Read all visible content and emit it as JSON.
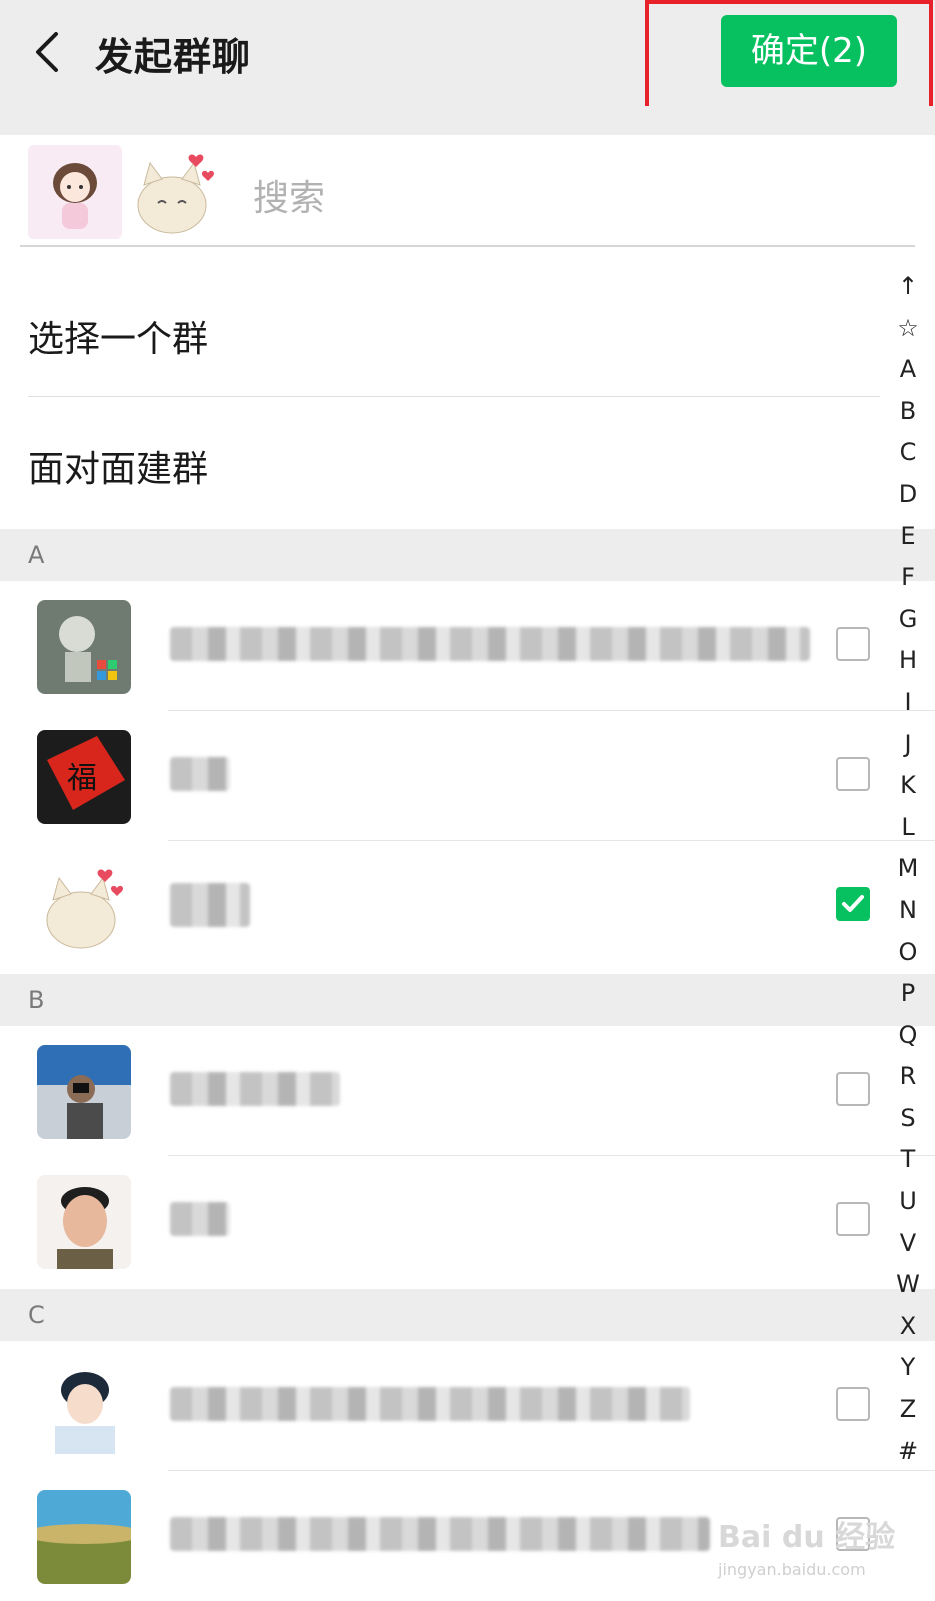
{
  "header": {
    "title": "发起群聊",
    "confirm_label": "确定(2)"
  },
  "search": {
    "placeholder": "搜索"
  },
  "menu": {
    "select_group": "选择一个群",
    "face_to_face": "面对面建群"
  },
  "sections": [
    {
      "letter": "A",
      "contacts": [
        {
          "avatar": "cartoon-boy-avatar",
          "checked": false
        },
        {
          "avatar": "fu-character-avatar",
          "checked": false
        },
        {
          "avatar": "cat-hearts-avatar",
          "checked": true
        }
      ]
    },
    {
      "letter": "B",
      "contacts": [
        {
          "avatar": "photographer-avatar",
          "checked": false
        },
        {
          "avatar": "selfie-man-avatar",
          "checked": false
        }
      ]
    },
    {
      "letter": "C",
      "contacts": [
        {
          "avatar": "anime-boy-avatar",
          "checked": false
        },
        {
          "avatar": "landscape-avatar",
          "checked": false
        }
      ]
    }
  ],
  "index_letters": [
    "↑",
    "☆",
    "A",
    "B",
    "C",
    "D",
    "E",
    "F",
    "G",
    "H",
    "I",
    "J",
    "K",
    "L",
    "M",
    "N",
    "O",
    "P",
    "Q",
    "R",
    "S",
    "T",
    "U",
    "V",
    "W",
    "X",
    "Y",
    "Z",
    "#"
  ],
  "watermark": {
    "brand": "Bai du 经验",
    "url": "jingyan.baidu.com"
  },
  "colors": {
    "accent": "#07c160",
    "highlight_box": "#e8202a"
  }
}
